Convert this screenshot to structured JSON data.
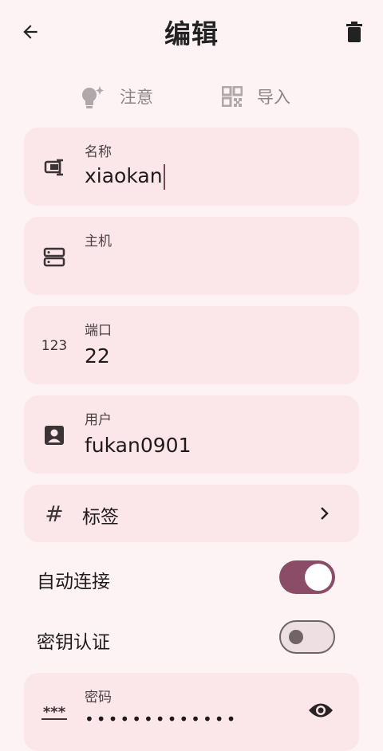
{
  "header": {
    "title": "编辑",
    "back_icon": "arrow-left-icon",
    "delete_icon": "trash-icon"
  },
  "actions": {
    "note": {
      "label": "注意",
      "icon": "lightbulb-icon"
    },
    "import": {
      "label": "导入",
      "icon": "qr-code-icon"
    }
  },
  "fields": {
    "name": {
      "label": "名称",
      "value": "xiaokan",
      "icon": "label-icon"
    },
    "host": {
      "label": "主机",
      "value": "",
      "icon": "server-icon"
    },
    "port": {
      "label": "端口",
      "value": "22",
      "icon_text": "123"
    },
    "user": {
      "label": "用户",
      "value": "fukan0901",
      "icon": "account-box-icon"
    },
    "tags": {
      "label": "标签",
      "icon_text": "#",
      "chevron": "chevron-right-icon"
    },
    "password": {
      "label": "密码",
      "value": "•••••••••••••",
      "icon_text": "***",
      "eye": "eye-icon"
    }
  },
  "toggles": {
    "auto_connect": {
      "label": "自动连接",
      "on": true
    },
    "key_auth": {
      "label": "密钥认证",
      "on": false
    }
  },
  "colors": {
    "background": "#fdf3f4",
    "card": "#fbe6ea",
    "accent": "#8a4c66"
  }
}
